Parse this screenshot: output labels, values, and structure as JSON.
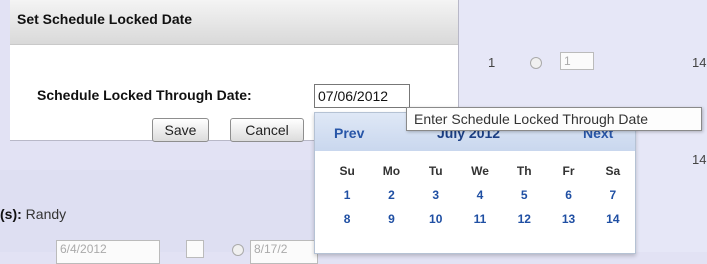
{
  "dialog": {
    "title": "Set Schedule Locked Date",
    "field_label": "Schedule Locked Through Date:",
    "date_value": "07/06/2012",
    "save_label": "Save",
    "cancel_label": "Cancel"
  },
  "tooltip": {
    "text": "Enter Schedule Locked Through Date"
  },
  "calendar": {
    "prev_label": "Prev",
    "month_label": "July 2012",
    "next_label": "Next",
    "weekdays": [
      "Su",
      "Mo",
      "Tu",
      "We",
      "Th",
      "Fr",
      "Sa"
    ],
    "weeks": [
      [
        "1",
        "2",
        "3",
        "4",
        "5",
        "6",
        "7"
      ],
      [
        "8",
        "9",
        "10",
        "11",
        "12",
        "13",
        "14"
      ]
    ]
  },
  "background": {
    "row1_number": "1",
    "row1_input": "1",
    "row1_right": "14",
    "row2_right": "14",
    "owners_label": "(s):",
    "owners_value": "Randy",
    "bottom_date_1": "6/4/2012",
    "bottom_date_2": "8/17/2"
  }
}
